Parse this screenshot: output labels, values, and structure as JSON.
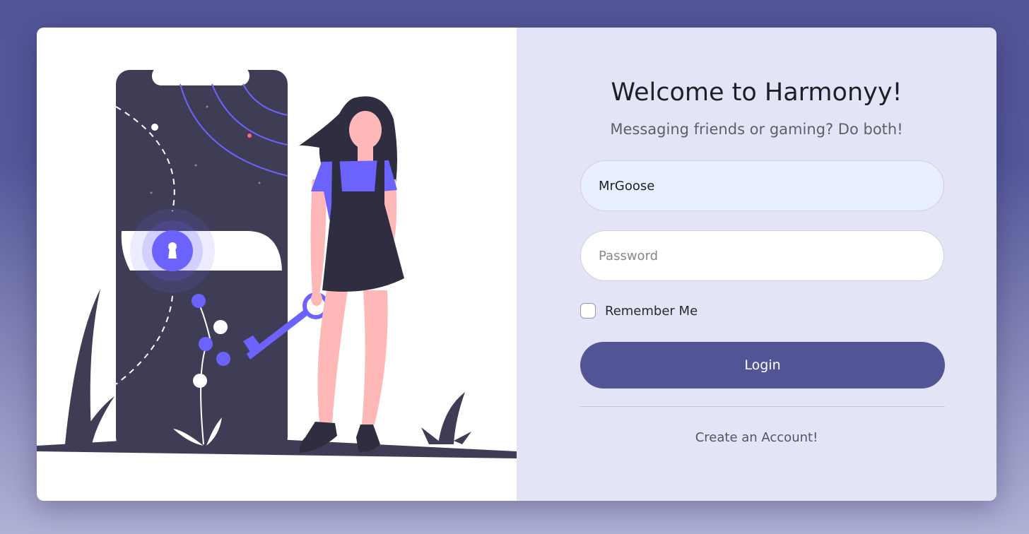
{
  "login": {
    "title": "Welcome to Harmonyy!",
    "subtitle": "Messaging friends or gaming? Do both!",
    "username_value": "MrGoose",
    "password_placeholder": "Password",
    "remember_label": "Remember Me",
    "login_label": "Login",
    "create_account_label": "Create an Account!"
  },
  "colors": {
    "background": "#535597",
    "panel": "#e4e4f7",
    "accent": "#535496",
    "illustration_dark": "#3f3d56",
    "illustration_purple": "#6c63ff"
  }
}
